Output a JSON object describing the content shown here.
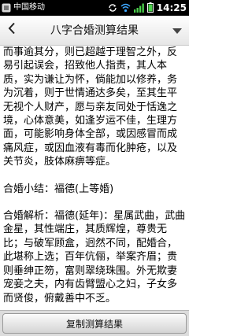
{
  "status_bar": {
    "carrier": "中国移动",
    "time": "14:25",
    "icons": [
      "app-notification-icon",
      "sync-icon",
      "wifi-icon",
      "signal-icon",
      "battery-icon"
    ]
  },
  "header": {
    "title": "八字合婚测算结果",
    "back_icon": "chevron-left-icon",
    "menu_icon": "dropdown-arrow-icon"
  },
  "content": {
    "paragraph_1": "而事逾其分，则已超越于理智之外，反易引起误会，招致他人指责，其人本质，实为谦让为怀，倘能加以修养，务为沉着，则于世情通达多矣，至其生平无视个人财产，愿与亲友同处于恬逸之境，心体意美，如逢岁运不佳，生理方面，可能影响身体全部，或因感冒而成痛风症，或因血液有毒而化肿疮，以及关节炎，肢体麻痹等症。",
    "paragraph_2": "合婚小结：福德(上等婚)",
    "paragraph_3": "合婚解析：福德(延年)：星属武曲，武曲金星，其性端庄，其质辉煌，尊贵无比；与破军顾盒，迥然不同，配婚合，此堪称上选；百年伉俪，举案齐眉；贵则垂绅正笏，富则翠绕珠围。外无欺妻宠妾之夫，内有齿臂盟心之妇，子女多而贤俊，俯戴善中不乏。"
  },
  "footer": {
    "copy_button_label": "复制测算结果"
  },
  "colors": {
    "status_bar": "#000000",
    "title_bar": "#f0f0f0",
    "bottom_bar": "#dcdcdc",
    "text": "#000000"
  }
}
